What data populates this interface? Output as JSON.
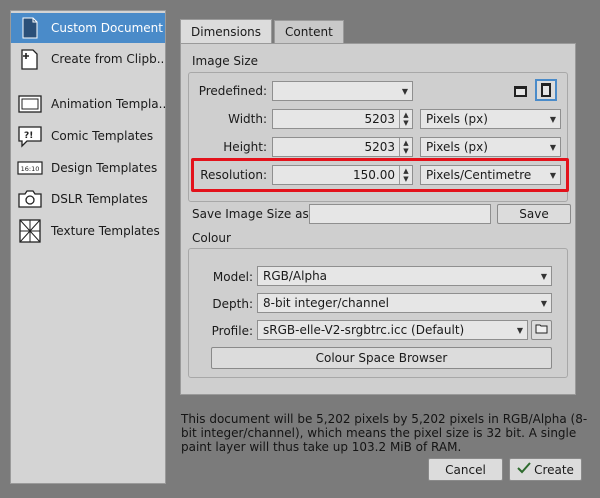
{
  "sidebar": {
    "items": [
      {
        "label": "Custom Document",
        "icon": "document-icon",
        "selected": true
      },
      {
        "label": "Create from Clipb...",
        "icon": "clipboard-document-icon",
        "selected": false
      },
      {
        "label": "Animation Templa...",
        "icon": "animation-icon",
        "selected": false
      },
      {
        "label": "Comic Templates",
        "icon": "speech-bubble-icon",
        "selected": false
      },
      {
        "label": "Design Templates",
        "icon": "ratio-icon",
        "selected": false,
        "icon_text": "16:10"
      },
      {
        "label": "DSLR Templates",
        "icon": "camera-icon",
        "selected": false
      },
      {
        "label": "Texture Templates",
        "icon": "texture-icon",
        "selected": false
      }
    ]
  },
  "tabs": [
    {
      "label": "Dimensions",
      "active": true
    },
    {
      "label": "Content",
      "active": false
    }
  ],
  "image_size": {
    "section_label": "Image Size",
    "predefined_label": "Predefined:",
    "predefined_value": "",
    "width_label": "Width:",
    "width_value": "5203",
    "width_unit": "Pixels (px)",
    "height_label": "Height:",
    "height_value": "5203",
    "height_unit": "Pixels (px)",
    "resolution_label": "Resolution:",
    "resolution_value": "150.00",
    "resolution_unit": "Pixels/Centimetre",
    "save_as_label": "Save Image Size as:",
    "save_as_value": "",
    "save_button": "Save"
  },
  "colour": {
    "section_label": "Colour",
    "model_label": "Model:",
    "model_value": "RGB/Alpha",
    "depth_label": "Depth:",
    "depth_value": "8-bit integer/channel",
    "profile_label": "Profile:",
    "profile_value": "sRGB-elle-V2-srgbtrc.icc (Default)",
    "browser_button": "Colour Space Browser"
  },
  "description": "This document will be 5,202 pixels by 5,202 pixels in RGB/Alpha (8-bit integer/channel), which means the pixel size is 32 bit. A single paint layer will thus take up 103.2 MiB of RAM.",
  "footer": {
    "cancel": "Cancel",
    "create": "Create"
  },
  "colors": {
    "selected": "#4a8bc9",
    "highlight": "#e3121b"
  }
}
